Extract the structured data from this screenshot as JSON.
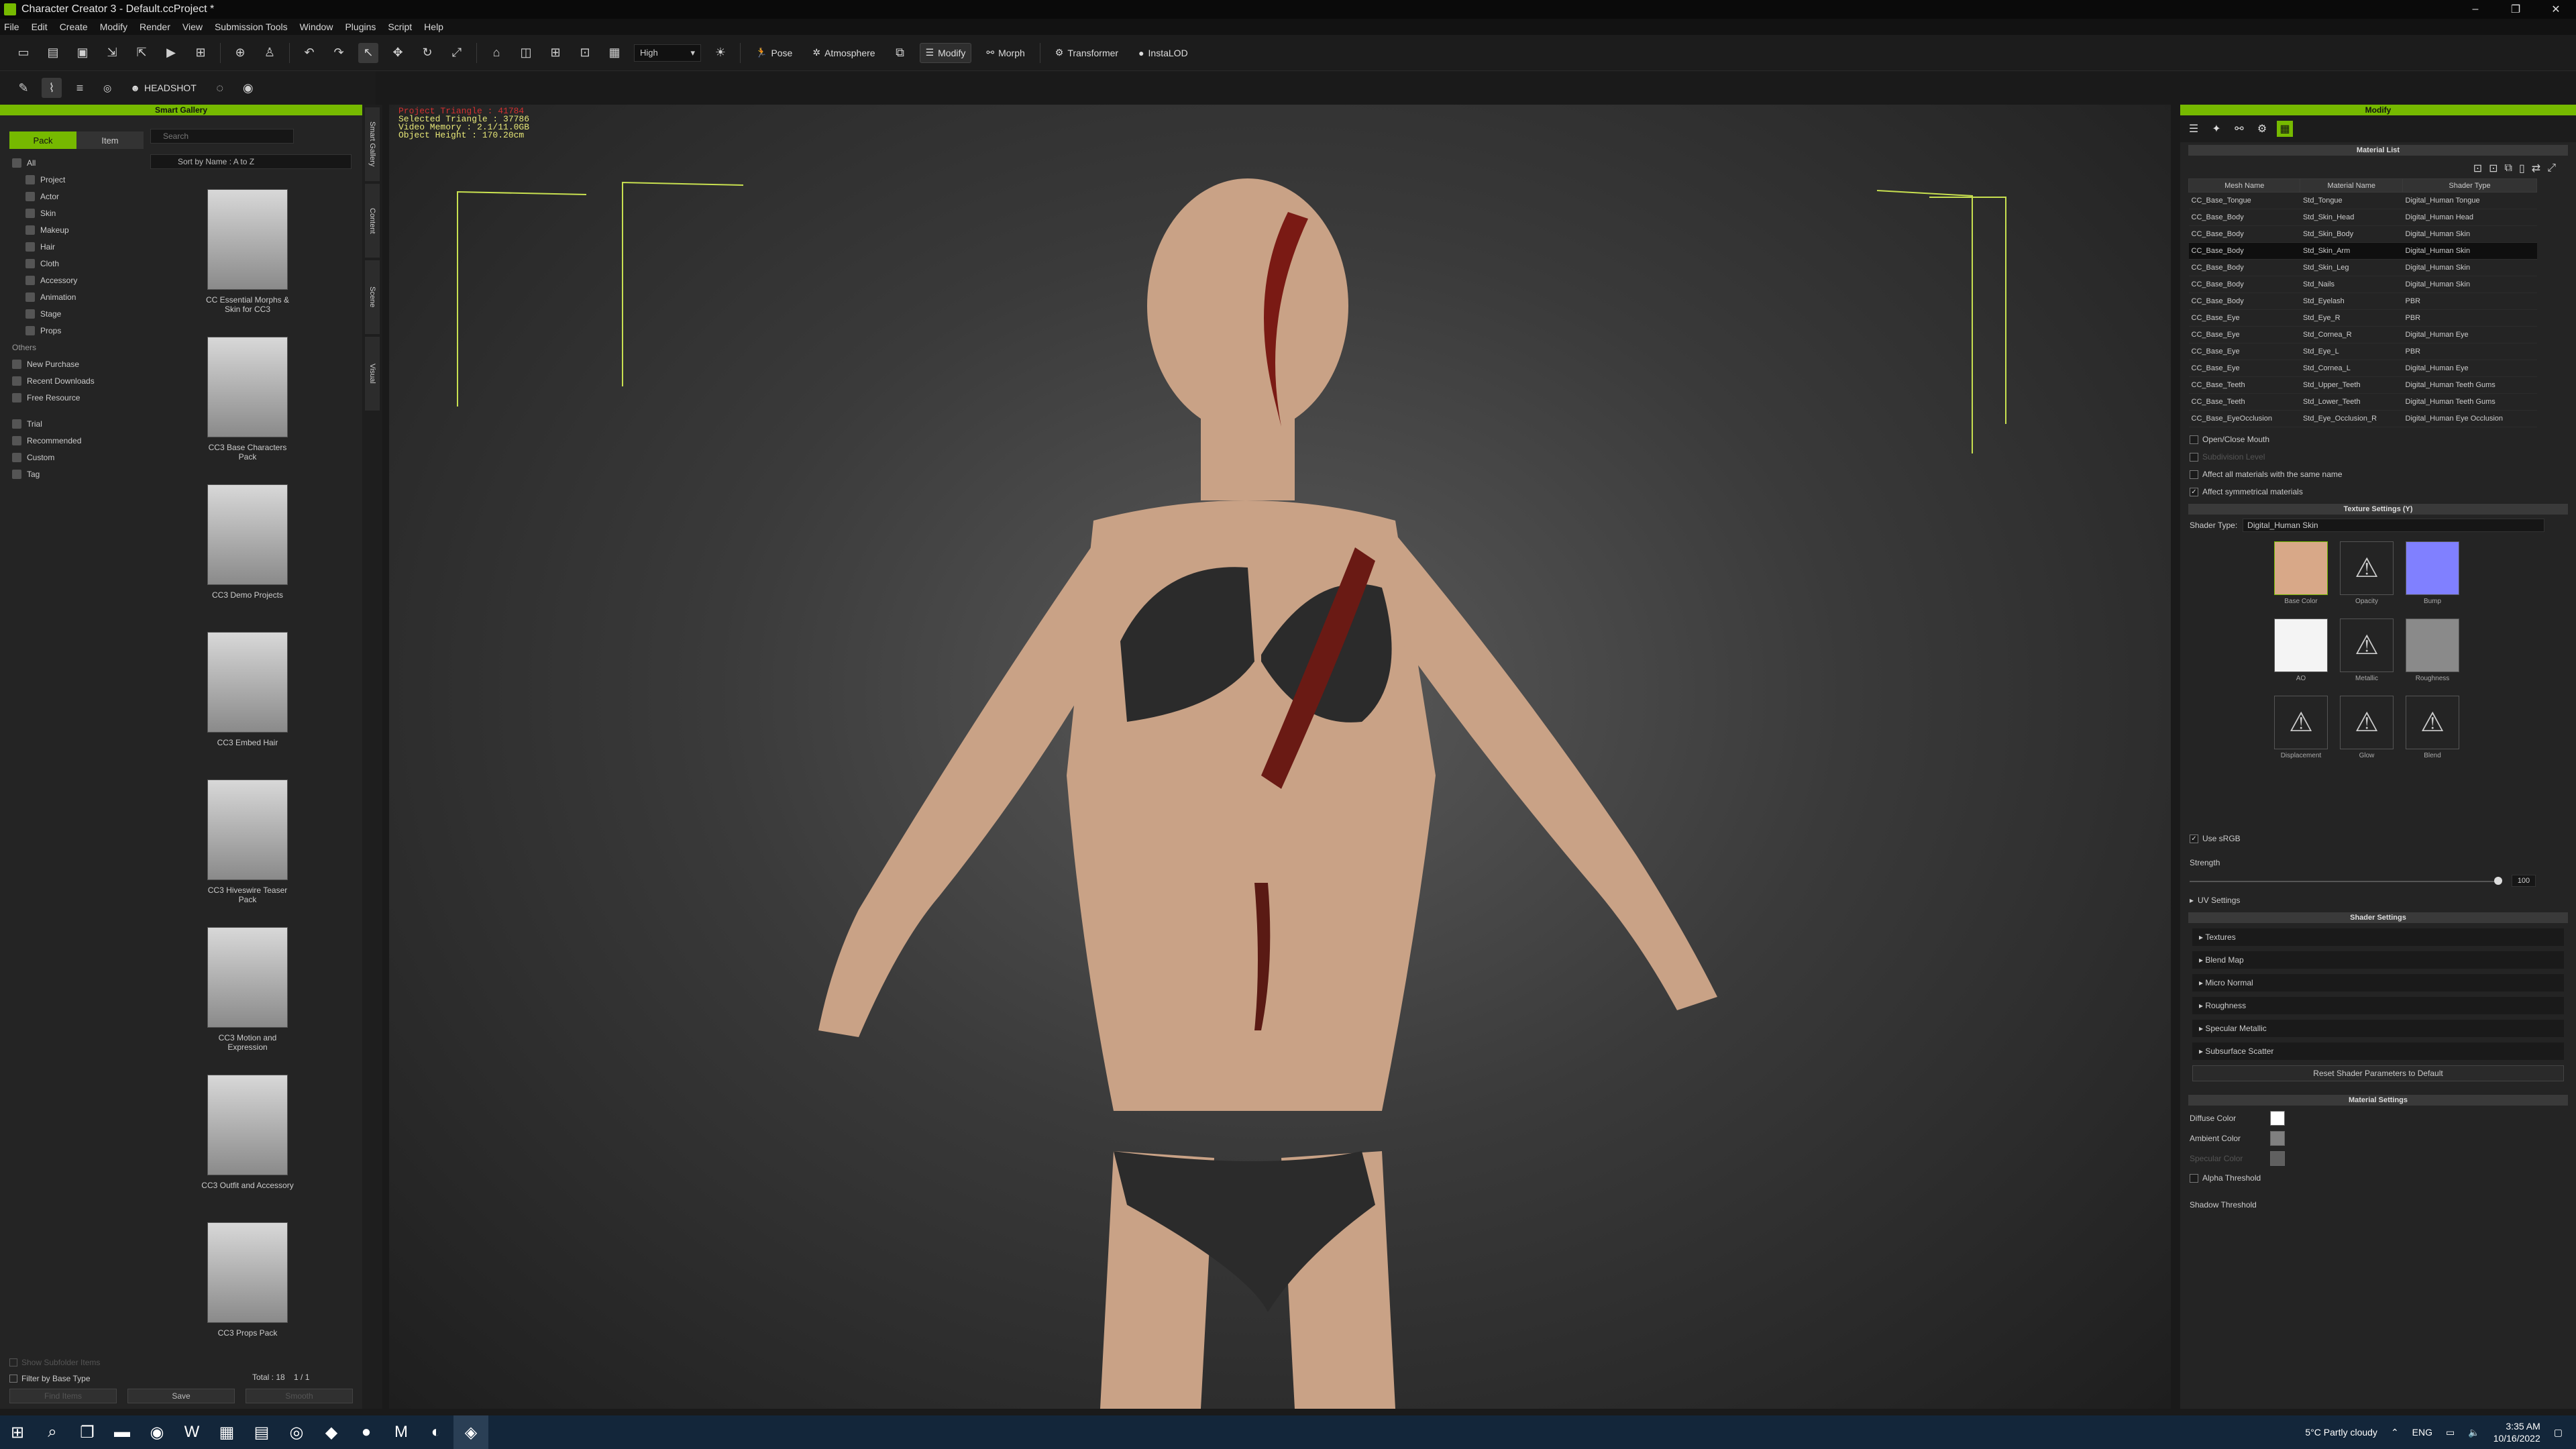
{
  "window": {
    "title": "Character Creator 3 - Default.ccProject *",
    "controls": [
      "–",
      "❐",
      "✕"
    ]
  },
  "menu": [
    "File",
    "Edit",
    "Create",
    "Modify",
    "Render",
    "View",
    "Submission Tools",
    "Window",
    "Plugins",
    "Script",
    "Help"
  ],
  "toolbar": {
    "quality": "High",
    "pose": "Pose",
    "atmosphere": "Atmosphere",
    "modify": "Modify",
    "morph": "Morph",
    "transformer": "Transformer",
    "instalod": "InstaLOD",
    "headshot": "HEADSHOT"
  },
  "smart_gallery": {
    "header": "Smart Gallery",
    "tabs": [
      "Pack",
      "Item"
    ],
    "search_placeholder": "Search",
    "sort": "Sort by Name : A to Z",
    "tree": [
      "All",
      "Project",
      "Actor",
      "Skin",
      "Makeup",
      "Hair",
      "Cloth",
      "Accessory",
      "Animation",
      "Stage",
      "Props"
    ],
    "others_header": "Others",
    "others": [
      "New Purchase",
      "Recent Downloads",
      "Free Resource"
    ],
    "filters": [
      "Trial",
      "Recommended",
      "Custom",
      "Tag"
    ],
    "packs": [
      "CC Essential Morphs & Skin for CC3",
      "CC3 Base Characters Pack",
      "CC3 Demo Projects",
      "CC3 Embed Hair",
      "CC3 Hiveswire Teaser Pack",
      "CC3 Motion and Expression",
      "CC3 Outfit and Accessory",
      "CC3 Props Pack"
    ],
    "show_subfolder": "Show Subfolder Items",
    "filter_base": "Filter by Base Type",
    "total": "Total : 18",
    "page": "1  /  1",
    "buttons": [
      "Find Items",
      "Save",
      "Smooth"
    ]
  },
  "side_tabs": [
    "Smart Gallery",
    "Content",
    "Scene",
    "Visual"
  ],
  "viewport": {
    "project_triangle": "Project Triangle : 41784",
    "selected_triangle": "Selected Triangle : 37786",
    "video_memory": "Video Memory : 2.1/11.0GB",
    "object_height": "Object Height : 170.20cm"
  },
  "modify": {
    "header": "Modify",
    "material_list_header": "Material List",
    "columns": [
      "Mesh Name",
      "Material Name",
      "Shader Type"
    ],
    "rows": [
      [
        "CC_Base_Tongue",
        "Std_Tongue",
        "Digital_Human Tongue"
      ],
      [
        "CC_Base_Body",
        "Std_Skin_Head",
        "Digital_Human Head"
      ],
      [
        "CC_Base_Body",
        "Std_Skin_Body",
        "Digital_Human Skin"
      ],
      [
        "CC_Base_Body",
        "Std_Skin_Arm",
        "Digital_Human Skin"
      ],
      [
        "CC_Base_Body",
        "Std_Skin_Leg",
        "Digital_Human Skin"
      ],
      [
        "CC_Base_Body",
        "Std_Nails",
        "Digital_Human Skin"
      ],
      [
        "CC_Base_Body",
        "Std_Eyelash",
        "PBR"
      ],
      [
        "CC_Base_Eye",
        "Std_Eye_R",
        "PBR"
      ],
      [
        "CC_Base_Eye",
        "Std_Cornea_R",
        "Digital_Human Eye"
      ],
      [
        "CC_Base_Eye",
        "Std_Eye_L",
        "PBR"
      ],
      [
        "CC_Base_Eye",
        "Std_Cornea_L",
        "Digital_Human Eye"
      ],
      [
        "CC_Base_Teeth",
        "Std_Upper_Teeth",
        "Digital_Human Teeth Gums"
      ],
      [
        "CC_Base_Teeth",
        "Std_Lower_Teeth",
        "Digital_Human Teeth Gums"
      ],
      [
        "CC_Base_EyeOcclusion",
        "Std_Eye_Occlusion_R",
        "Digital_Human Eye Occlusion"
      ]
    ],
    "open_close_mouth": "Open/Close Mouth",
    "subdivision": "Subdivision Level",
    "affect_same_name": "Affect all materials with the same name",
    "affect_symmetrical": "Affect symmetrical materials",
    "texture_settings_header": "Texture Settings (Y)",
    "shader_type_label": "Shader Type:",
    "shader_type_value": "Digital_Human Skin",
    "textures": [
      "Base Color",
      "Opacity",
      "Bump",
      "AO",
      "Metallic",
      "Roughness",
      "Displacement",
      "Glow",
      "Blend"
    ],
    "use_srgb": "Use sRGB",
    "strength_label": "Strength",
    "strength_value": "100",
    "uv_settings": "UV Settings",
    "shader_settings_header": "Shader Settings",
    "shader_sections": [
      "Textures",
      "Blend Map",
      "Micro Normal",
      "Roughness",
      "Specular Metallic",
      "Subsurface Scatter"
    ],
    "reset_button": "Reset Shader Parameters to Default",
    "material_settings_header": "Material Settings",
    "diffuse_color": "Diffuse Color",
    "ambient_color": "Ambient Color",
    "specular_color": "Specular Color",
    "alpha_threshold": "Alpha Threshold",
    "shadow_threshold": "Shadow Threshold"
  },
  "taskbar": {
    "weather": "5°C  Partly cloudy",
    "lang": "ENG",
    "time": "3:35 AM",
    "date": "10/16/2022"
  },
  "colors": {
    "accent": "#76b900",
    "taskbar": "#13263a"
  }
}
